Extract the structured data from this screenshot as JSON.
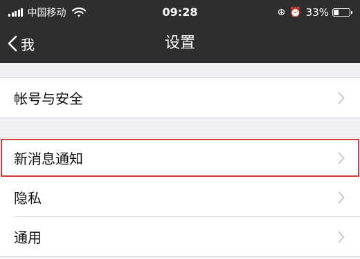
{
  "status_bar": {
    "carrier": "中国移动",
    "time": "09:28",
    "battery_percent": "33%",
    "battery_level": 0.33,
    "icons": [
      "signal-icon",
      "wifi-icon",
      "orientation-lock-icon",
      "alarm-icon",
      "battery-icon"
    ]
  },
  "nav": {
    "back_label": "我",
    "title": "设置"
  },
  "groups": [
    {
      "items": [
        {
          "label": "帐号与安全",
          "icon": "chevron-right-icon"
        }
      ]
    },
    {
      "items": [
        {
          "label": "新消息通知",
          "icon": "chevron-right-icon",
          "highlighted": true
        },
        {
          "label": "隐私",
          "icon": "chevron-right-icon"
        },
        {
          "label": "通用",
          "icon": "chevron-right-icon"
        }
      ]
    }
  ],
  "colors": {
    "header_bg": "#2e2e30",
    "page_bg": "#efeff4",
    "highlight": "#cf3a3a"
  }
}
